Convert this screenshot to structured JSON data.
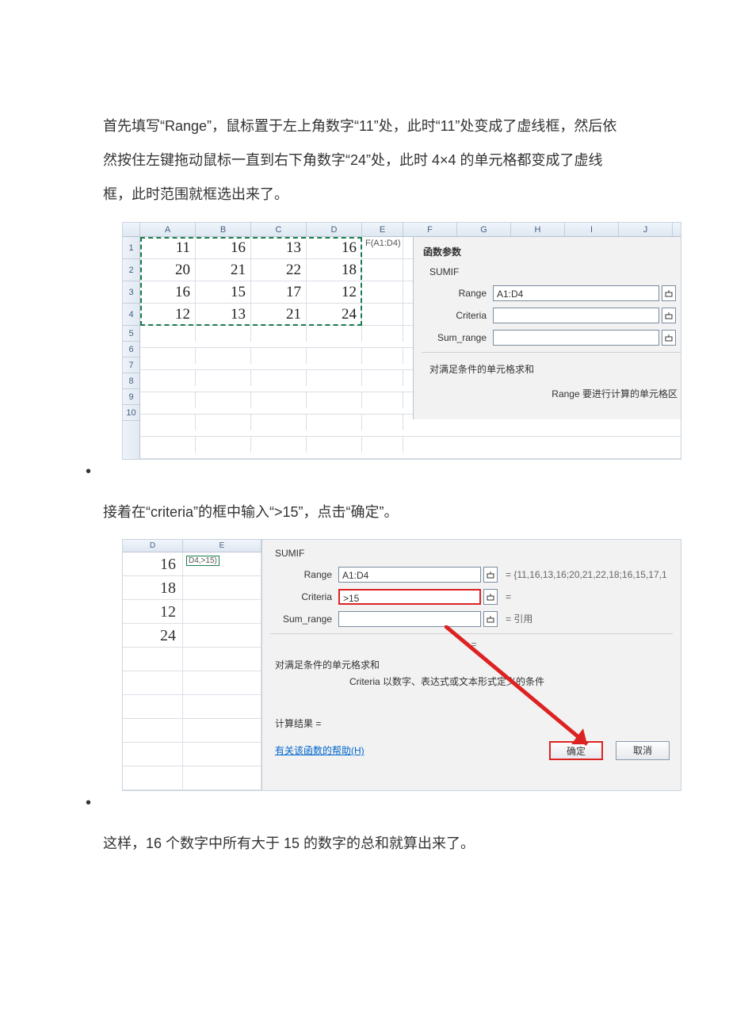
{
  "para1": "首先填写“Range”，鼠标置于左上角数字“11”处，此时“11”处变成了虚线框，然后依然按住左键拖动鼠标一直到右下角数字“24”处，此时 4×4 的单元格都变成了虚线框，此时范围就框选出来了。",
  "para2": "接着在“criteria”的框中输入“>15”，点击“确定”。",
  "para3": "这样，16 个数字中所有大于 15 的数字的总和就算出来了。",
  "shot1": {
    "cols": [
      "A",
      "B",
      "C",
      "D",
      "E",
      "F",
      "G",
      "H",
      "I",
      "J"
    ],
    "rows": [
      "1",
      "2",
      "3",
      "4",
      "5",
      "6",
      "7",
      "8",
      "9",
      "10"
    ],
    "grid": [
      [
        "11",
        "16",
        "13",
        "16"
      ],
      [
        "20",
        "21",
        "22",
        "18"
      ],
      [
        "16",
        "15",
        "17",
        "12"
      ],
      [
        "12",
        "13",
        "21",
        "24"
      ]
    ],
    "formula": "F(A1:D4)",
    "dlg": {
      "title": "函数参数",
      "fn": "SUMIF",
      "range_label": "Range",
      "range_val": "A1:D4",
      "criteria_label": "Criteria",
      "sumrange_label": "Sum_range",
      "desc": "对满足条件的单元格求和",
      "hint": "Range  要进行计算的单元格区"
    }
  },
  "shot2": {
    "left_cols": [
      "D",
      "E"
    ],
    "left_vals": [
      "16",
      "18",
      "12",
      "24"
    ],
    "ftext": "D4,>15)",
    "dlg": {
      "fn": "SUMIF",
      "range_label": "Range",
      "range_val": "A1:D4",
      "range_eq": "= {11,16,13,16;20,21,22,18;16,15,17,1",
      "criteria_label": "Criteria",
      "criteria_val": ">15",
      "criteria_eq": "=",
      "sumrange_label": "Sum_range",
      "sumrange_eq": "= 引用",
      "eq_line": "=",
      "desc": "对满足条件的单元格求和",
      "crit_desc": "Criteria  以数字、表达式或文本形式定义的条件",
      "result": "计算结果 =",
      "help": "有关该函数的帮助(H)",
      "ok": "确定",
      "cancel": "取消"
    }
  }
}
